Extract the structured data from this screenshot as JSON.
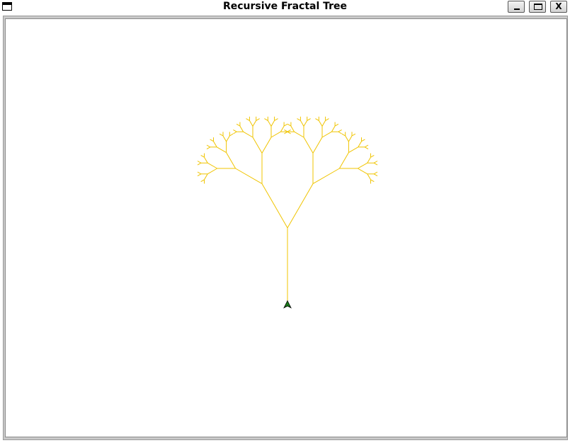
{
  "window": {
    "title": "Recursive Fractal Tree",
    "controls": {
      "minimize_glyph": "minimize-icon",
      "maximize_glyph": "maximize-icon",
      "close_label": "X"
    }
  },
  "tree": {
    "depth": 7,
    "branch_angle_deg": 30,
    "length_ratio": 0.6,
    "color": "#f0c400"
  },
  "turtle": {
    "icon": "turtle-arrow-icon",
    "fill_color": "#1a7a1a",
    "outline_color": "#000000"
  },
  "colors": {
    "background": "#ffffff",
    "frame": "#c9c9c9"
  }
}
